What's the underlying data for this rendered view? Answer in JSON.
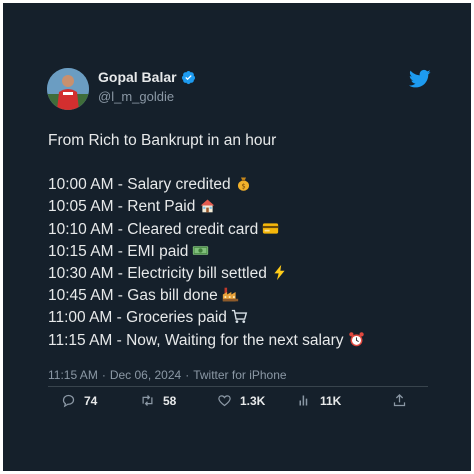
{
  "user": {
    "display_name": "Gopal Balar",
    "handle": "@l_m_goldie",
    "verified_icon": "verified-badge-icon",
    "avatar": "avatar"
  },
  "logo": "twitter-bird-icon",
  "tweet": {
    "headline": "From Rich to Bankrupt in an hour",
    "lines": [
      {
        "text": "10:00 AM - Salary credited",
        "emoji": "money-bag-icon"
      },
      {
        "text": "10:05 AM - Rent Paid",
        "emoji": "house-icon"
      },
      {
        "text": "10:10 AM - Cleared credit card",
        "emoji": "credit-card-icon"
      },
      {
        "text": "10:15 AM - EMI paid",
        "emoji": "banknote-icon"
      },
      {
        "text": "10:30 AM - Electricity bill settled",
        "emoji": "lightning-icon"
      },
      {
        "text": "10:45 AM - Gas bill done",
        "emoji": "factory-icon"
      },
      {
        "text": "11:00 AM - Groceries paid",
        "emoji": "shopping-cart-icon"
      },
      {
        "text": "11:15 AM - Now, Waiting for the next salary",
        "emoji": "alarm-clock-icon"
      }
    ]
  },
  "meta": {
    "time": "11:15 AM",
    "separator": "·",
    "date": "Dec 06, 2024",
    "source": "Twitter for iPhone"
  },
  "actions": {
    "replies": "74",
    "retweets": "58",
    "likes": "1.3K",
    "views": "11K"
  },
  "colors": {
    "background": "#15202b",
    "text": "#e7e9ea",
    "secondary": "#8b98a5",
    "twitter_blue": "#1d9bf0"
  }
}
